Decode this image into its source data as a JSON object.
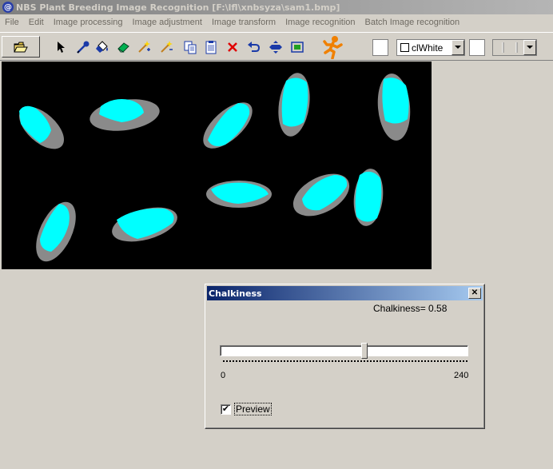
{
  "window": {
    "app_icon_glyph": "@",
    "title": "NBS Plant Breeding Image Recognition [F:\\lfl\\xnbsyza\\sam1.bmp]"
  },
  "menu": [
    "File",
    "Edit",
    "Image processing",
    "Image adjustment",
    "Image transform",
    "Image recognition",
    "Batch Image recognition"
  ],
  "toolbar": {
    "icons": [
      "open-folder-icon",
      "pointer-arrow-icon",
      "eyedropper-icon",
      "paint-bucket-icon",
      "eraser-icon",
      "magic-wand-add-icon",
      "magic-wand-remove-icon",
      "copy-icon",
      "paste-icon",
      "delete-x-icon",
      "undo-icon",
      "fit-center-icon",
      "zoom-fit-icon",
      "running-man-icon"
    ],
    "color_select_value": "clWhite"
  },
  "colors": {
    "grain_gray": "#8a8a8a",
    "chalky_cyan": "#00ffff",
    "dialog_title_start": "#0a246a",
    "dialog_title_end": "#a6caf0"
  },
  "dialog": {
    "title": "Chalkiness",
    "close_label": "✕",
    "readout": "Chalkiness= 0.58",
    "slider_value": 140,
    "min_label": "0",
    "max_label": "240",
    "preview_checked_glyph": "✔",
    "preview_label": "Preview"
  }
}
